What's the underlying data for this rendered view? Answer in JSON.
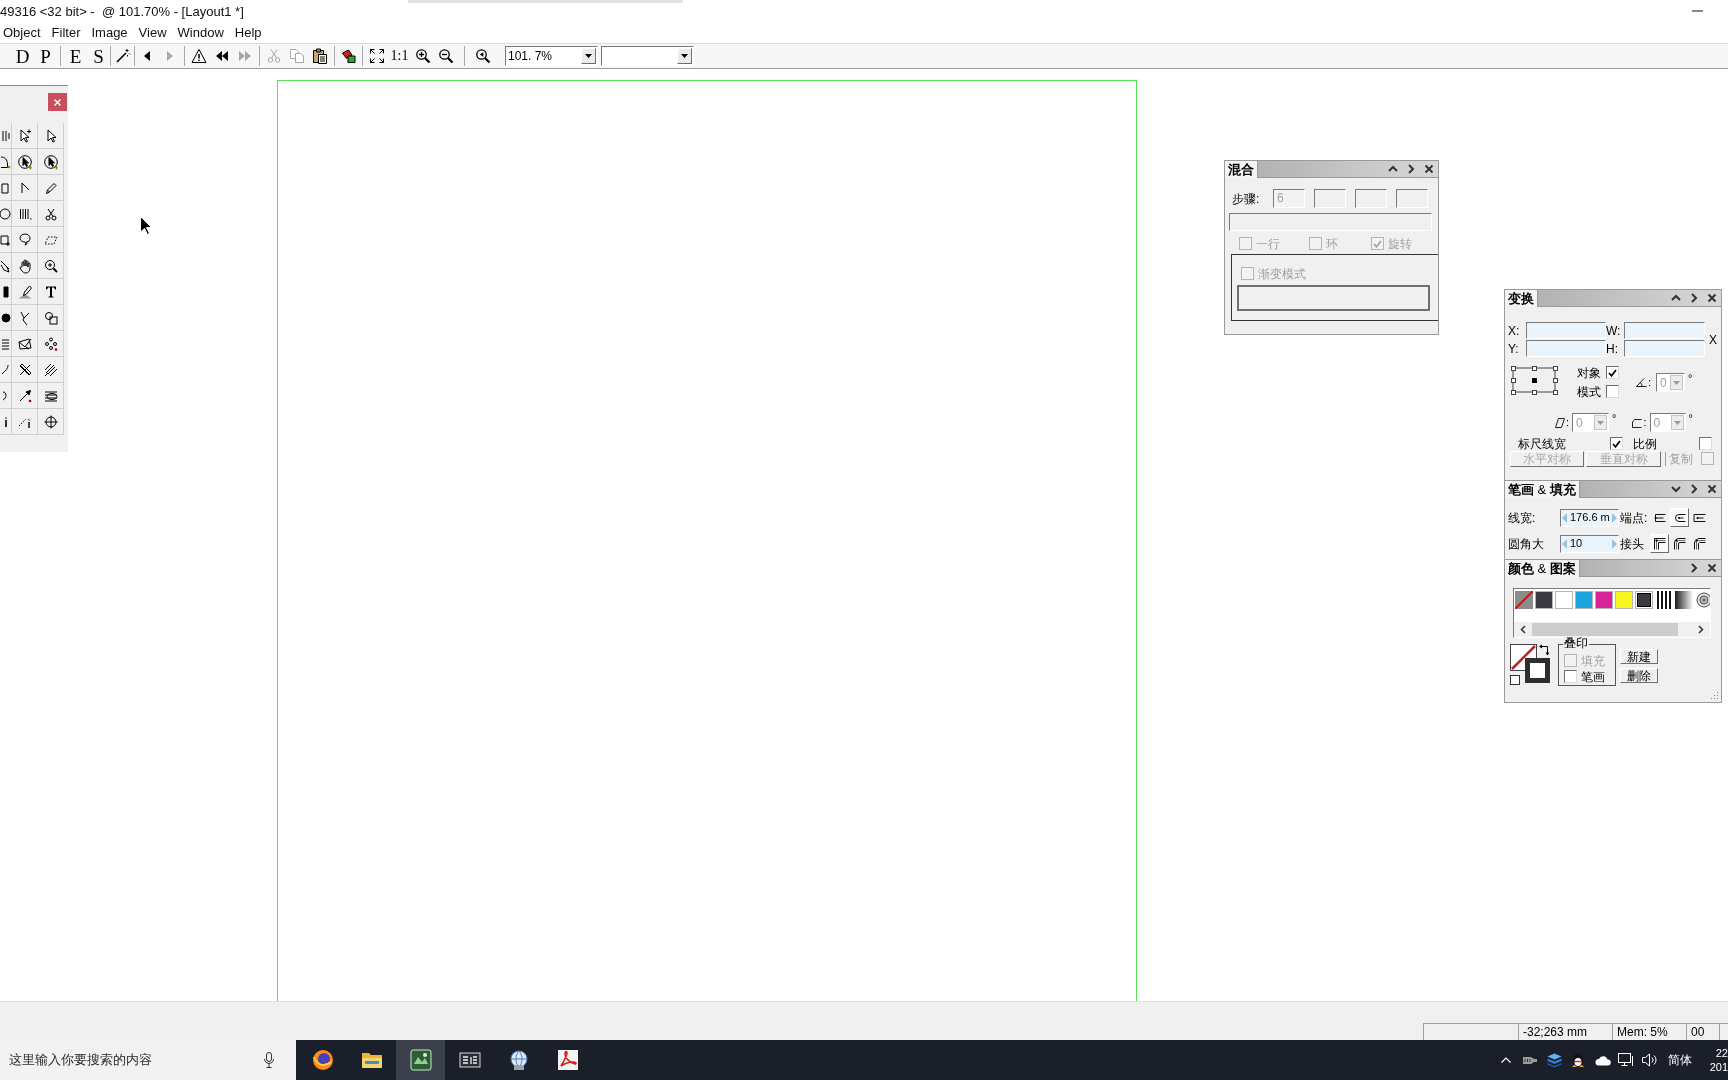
{
  "window": {
    "title": "49316 <32 bit> -  @ 101.70% - [Layout1 *]"
  },
  "menu": [
    "Object",
    "Filter",
    "Image",
    "View",
    "Window",
    "Help"
  ],
  "toolbar": {
    "groups": [
      [
        {
          "kind": "letter",
          "label": "D",
          "disabled": false
        },
        {
          "kind": "letter",
          "label": "P",
          "disabled": false
        }
      ],
      [
        {
          "kind": "letter",
          "label": "E",
          "disabled": false
        },
        {
          "kind": "letter",
          "label": "S",
          "disabled": false
        }
      ],
      [
        {
          "kind": "icon",
          "disabled": false
        }
      ],
      [
        {
          "kind": "icon",
          "disabled": false
        },
        {
          "kind": "icon",
          "disabled": true
        }
      ],
      [
        {
          "kind": "icon",
          "disabled": false
        },
        {
          "kind": "icon",
          "disabled": false
        },
        {
          "kind": "icon",
          "disabled": true
        }
      ],
      [
        {
          "kind": "icon",
          "disabled": true
        },
        {
          "kind": "icon",
          "disabled": true
        },
        {
          "kind": "icon",
          "disabled": false
        }
      ],
      [
        {
          "kind": "icon",
          "disabled": false
        }
      ],
      [
        {
          "kind": "icon",
          "disabled": false
        },
        {
          "kind": "text",
          "label": "1:1",
          "disabled": false
        },
        {
          "kind": "icon",
          "disabled": false
        },
        {
          "kind": "icon",
          "disabled": false
        }
      ],
      [
        {
          "kind": "icon",
          "disabled": false
        }
      ]
    ],
    "zoom": {
      "value": "101. 7%"
    }
  },
  "blend_panel": {
    "title": "混合",
    "steps": {
      "label": "步骤:",
      "value": "6",
      "disabled": true
    },
    "options": [
      {
        "label": "一行",
        "checked": false,
        "disabled": true
      },
      {
        "label": "环",
        "checked": false,
        "disabled": true
      },
      {
        "label": "旋转",
        "checked": true,
        "disabled": true
      }
    ],
    "gradient_mode": {
      "label": "渐变模式",
      "checked": false,
      "disabled": true
    }
  },
  "transform_panel": {
    "title": "变换",
    "fields": [
      {
        "label": "X:"
      },
      {
        "label": "W:"
      },
      {
        "label": "Y:"
      },
      {
        "label": "H:"
      }
    ],
    "side_label": "X",
    "apply_to": [
      {
        "label": "对象",
        "checked": true
      },
      {
        "label": "模式",
        "checked": false
      }
    ],
    "rotation": {
      "label": ":",
      "value": "0",
      "unit": "°",
      "disabled": true
    },
    "skew": [
      {
        "label": ":",
        "value": "0",
        "unit": "°",
        "disabled": true
      },
      {
        "label": ":",
        "value": "0",
        "unit": "°",
        "disabled": true
      }
    ],
    "scale_stroke": {
      "label": "标尺线宽",
      "checked": true
    },
    "proportional": {
      "label": "比例",
      "checked": false
    },
    "buttons": [
      {
        "label": "水平对称",
        "disabled": true
      },
      {
        "label": "垂直对称",
        "disabled": true
      }
    ],
    "copy": {
      "label": "复制",
      "checked": false,
      "disabled": true
    }
  },
  "stroke_fill_panel": {
    "title": "**笔画** & **填充**",
    "width": {
      "label": "线宽:",
      "value": "176.6 m"
    },
    "caps": {
      "label": "端点:",
      "options": [
        {
          "selected": false
        },
        {
          "selected": true
        },
        {
          "selected": false
        }
      ]
    },
    "corner": {
      "label": "圆角大",
      "value": "10"
    },
    "joins": {
      "label": "接头",
      "options": [
        {
          "selected": true
        },
        {
          "selected": false
        },
        {
          "selected": false
        }
      ]
    }
  },
  "color_panel": {
    "title": "**颜色** & **图案**",
    "swatches": [
      {
        "kind": "none"
      },
      {
        "kind": "solid",
        "color": "#3a3a40"
      },
      {
        "kind": "solid",
        "color": "#ffffff"
      },
      {
        "kind": "solid",
        "color": "#1ca5dc"
      },
      {
        "kind": "solid",
        "color": "#d8239b"
      },
      {
        "kind": "solid",
        "color": "#f5f520"
      },
      {
        "kind": "framed"
      },
      {
        "kind": "stripes"
      },
      {
        "kind": "gradient"
      },
      {
        "kind": "radial"
      }
    ],
    "overprint": {
      "label": "叠印",
      "options": [
        {
          "label": "填充",
          "checked": false,
          "disabled": true
        },
        {
          "label": "笔画",
          "checked": false,
          "disabled": false
        }
      ]
    },
    "buttons": [
      {
        "label": "新建"
      },
      {
        "label": "删除"
      }
    ]
  },
  "status_bar": {
    "cells": [
      "-32;263 mm",
      "Mem: 5%",
      "00"
    ]
  },
  "taskbar": {
    "search": {
      "placeholder": "这里输入你要搜索的内容"
    },
    "apps": [
      {
        "active": false
      },
      {
        "active": false
      },
      {
        "active": true
      },
      {
        "active": false
      },
      {
        "active": false
      },
      {
        "active": false
      }
    ],
    "ime": "简体",
    "clock": [
      "22",
      "201"
    ]
  }
}
